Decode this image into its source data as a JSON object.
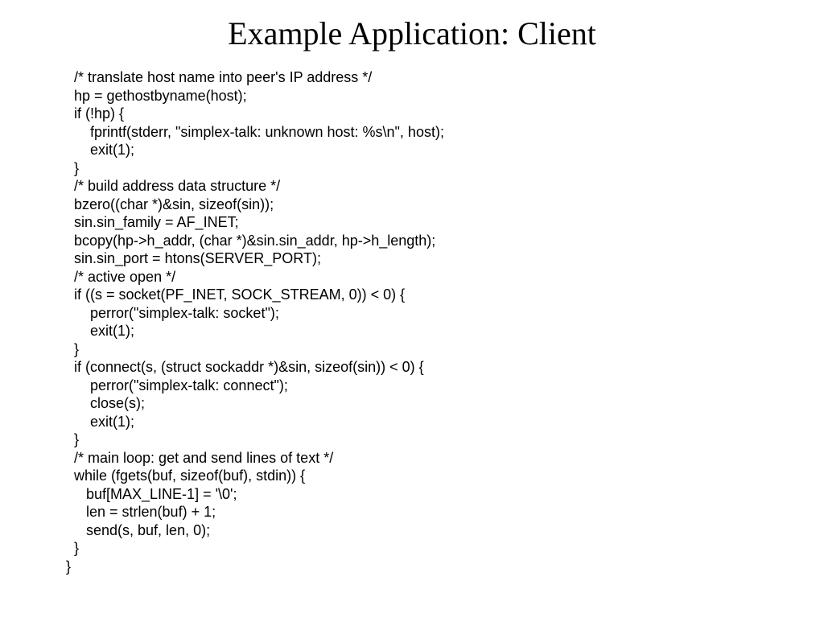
{
  "title": "Example Application: Client",
  "code": "  /* translate host name into peer's IP address */\n  hp = gethostbyname(host);\n  if (!hp) {\n      fprintf(stderr, \"simplex-talk: unknown host: %s\\n\", host);\n      exit(1);\n  }\n  /* build address data structure */\n  bzero((char *)&sin, sizeof(sin));\n  sin.sin_family = AF_INET;\n  bcopy(hp->h_addr, (char *)&sin.sin_addr, hp->h_length);\n  sin.sin_port = htons(SERVER_PORT);\n  /* active open */\n  if ((s = socket(PF_INET, SOCK_STREAM, 0)) < 0) {\n      perror(\"simplex-talk: socket\");\n      exit(1);\n  }\n  if (connect(s, (struct sockaddr *)&sin, sizeof(sin)) < 0) {\n      perror(\"simplex-talk: connect\");\n      close(s);\n      exit(1);\n  }\n  /* main loop: get and send lines of text */\n  while (fgets(buf, sizeof(buf), stdin)) {\n     buf[MAX_LINE-1] = '\\0';\n     len = strlen(buf) + 1;\n     send(s, buf, len, 0);\n  }\n}"
}
